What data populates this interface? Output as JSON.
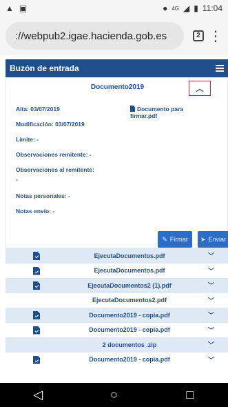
{
  "status": {
    "signal": "4G",
    "time": "11:04"
  },
  "browser": {
    "url": "://webpub2.igae.hacienda.gob.es",
    "tab_count": "2"
  },
  "inbox": {
    "title": "Buzón de entrada"
  },
  "document": {
    "title": "Documento2019",
    "alta": "Alta: 03/07/2019",
    "modificacion": "Modificación: 03/07/2019",
    "limite": "Límite: -",
    "obs_remitente": "Observaciones remitente: -",
    "obs_al_remitente": "Observaciones al remitente:",
    "obs_al_remitente_value": "-",
    "notas_personales": "Notas personales: -",
    "notas_envio": "Notas envío: -",
    "attachment": "Documento para firmar.pdf",
    "firmar_label": "Firmar",
    "enviar_label": "Enviar"
  },
  "files": [
    {
      "name": "EjecutaDocumentos.pdf",
      "signed": true
    },
    {
      "name": "EjecutaDocumentos.pdf",
      "signed": true
    },
    {
      "name": "EjecutaDocumentos2 (1).pdf",
      "signed": true
    },
    {
      "name": "EjecutaDocumentos2.pdf",
      "signed": false
    },
    {
      "name": "Documento2019 - copia.pdf",
      "signed": true
    },
    {
      "name": "Documento2019 - copia.pdf",
      "signed": true
    },
    {
      "name": "2 documentos .zip",
      "signed": false
    },
    {
      "name": "Documento2019 - copia.pdf",
      "signed": true
    }
  ],
  "icons": {
    "file_signed": "file-check-icon",
    "chevron": "chevron-down-icon",
    "collapse": "chevron-up-icon"
  },
  "colors": {
    "primary": "#1f4e8c",
    "button": "#2b6ec8",
    "row_alt": "#dfe9f5",
    "highlight": "#e02020"
  }
}
